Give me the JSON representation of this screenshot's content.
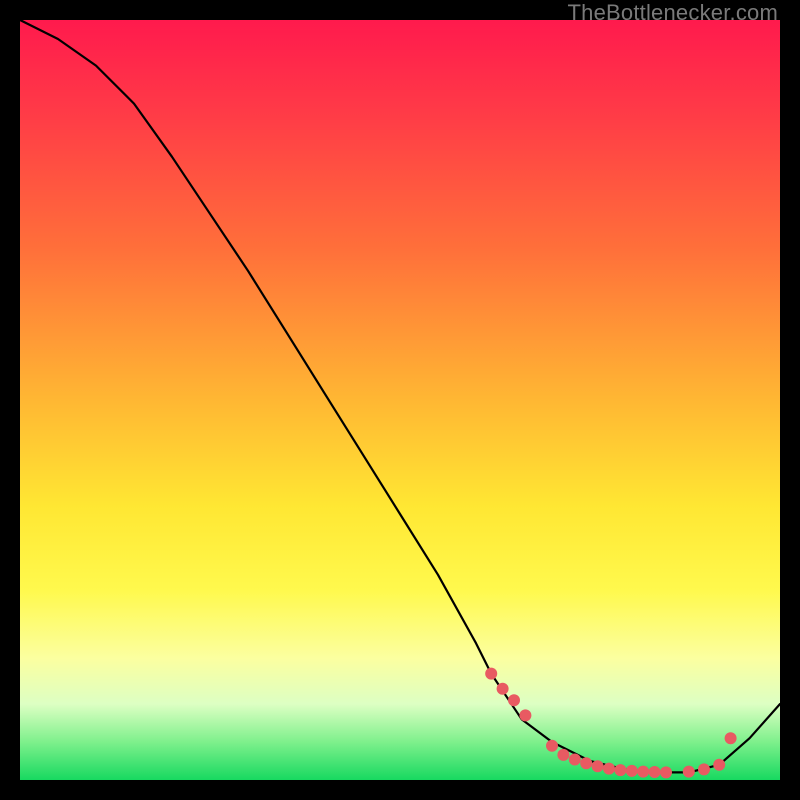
{
  "watermark": "TheBottlenecker.com",
  "chart_data": {
    "type": "line",
    "title": "",
    "xlabel": "",
    "ylabel": "",
    "xlim": [
      0,
      100
    ],
    "ylim": [
      0,
      100
    ],
    "series": [
      {
        "name": "curve",
        "x": [
          0,
          5,
          10,
          15,
          20,
          25,
          30,
          35,
          40,
          45,
          50,
          55,
          60,
          62,
          66,
          70,
          75,
          80,
          84,
          88,
          92,
          96,
          100
        ],
        "y": [
          100,
          97.5,
          94,
          89,
          82,
          74.5,
          67,
          59,
          51,
          43,
          35,
          27,
          18,
          14,
          8,
          5,
          2.5,
          1.3,
          1,
          1,
          2,
          5.5,
          10
        ]
      }
    ],
    "markers": {
      "name": "highlight-dots",
      "color": "#e85a62",
      "x": [
        62,
        63.5,
        65,
        66.5,
        70,
        71.5,
        73,
        74.5,
        76,
        77.5,
        79,
        80.5,
        82,
        83.5,
        85,
        88,
        90,
        92,
        93.5
      ],
      "y": [
        14,
        12,
        10.5,
        8.5,
        4.5,
        3.3,
        2.7,
        2.2,
        1.8,
        1.5,
        1.3,
        1.2,
        1.1,
        1.05,
        1,
        1.1,
        1.4,
        2,
        5.5
      ]
    }
  }
}
